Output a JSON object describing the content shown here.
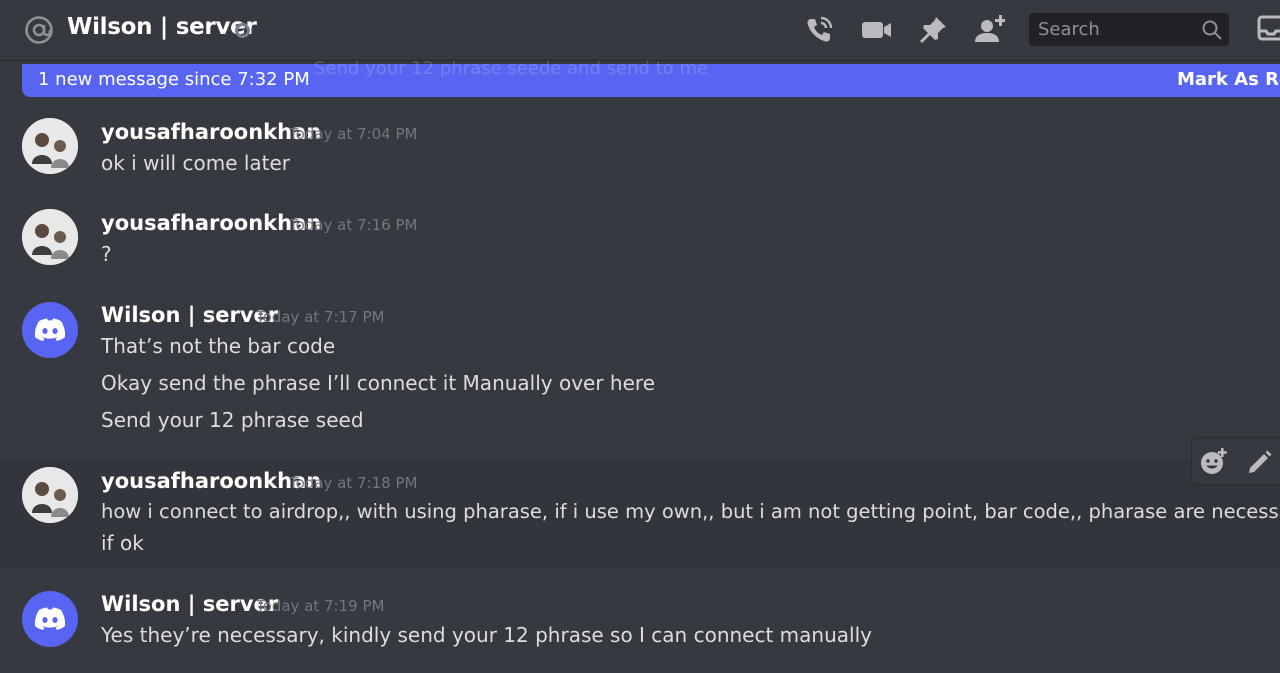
{
  "header": {
    "title": "Wilson | server",
    "search_placeholder": "Search",
    "icons": [
      "at-icon",
      "phone-call-icon",
      "video-camera-icon",
      "pin-icon",
      "add-member-icon",
      "search-icon",
      "inbox-icon"
    ]
  },
  "new_messages_bar": {
    "text": "1 new message since 7:32 PM",
    "ghost_text": "Send your 12 phrase seede and send to me",
    "action": "Mark As Read"
  },
  "messages": [
    {
      "author": "yousafharoonkhan",
      "timestamp": "Today at 7:04 PM",
      "avatar": "photo",
      "lines": [
        "ok i will come later"
      ]
    },
    {
      "author": "yousafharoonkhan",
      "timestamp": "Today at 7:16 PM",
      "avatar": "photo",
      "lines": [
        "?"
      ]
    },
    {
      "author": "Wilson | server",
      "timestamp": "Today at 7:17 PM",
      "avatar": "discord",
      "lines": [
        "That’s not the bar code",
        "Okay send the phrase I’ll connect it Manually over here",
        "Send your 12 phrase seed"
      ]
    },
    {
      "author": "yousafharoonkhan",
      "timestamp": "Today at 7:18 PM",
      "avatar": "photo",
      "lines": [
        "how i connect to airdrop,, with using pharase, if i use my own,, but i am not getting point, bar code,, pharase are necessary ok",
        "if ok"
      ]
    },
    {
      "author": "Wilson | server",
      "timestamp": "Today at 7:19 PM",
      "avatar": "discord",
      "lines": [
        "Yes they’re necessary, kindly send your 12 phrase so I can connect manually"
      ]
    }
  ],
  "colors": {
    "background": "#36393f",
    "accent": "#5865f2",
    "muted": "#72767d"
  }
}
